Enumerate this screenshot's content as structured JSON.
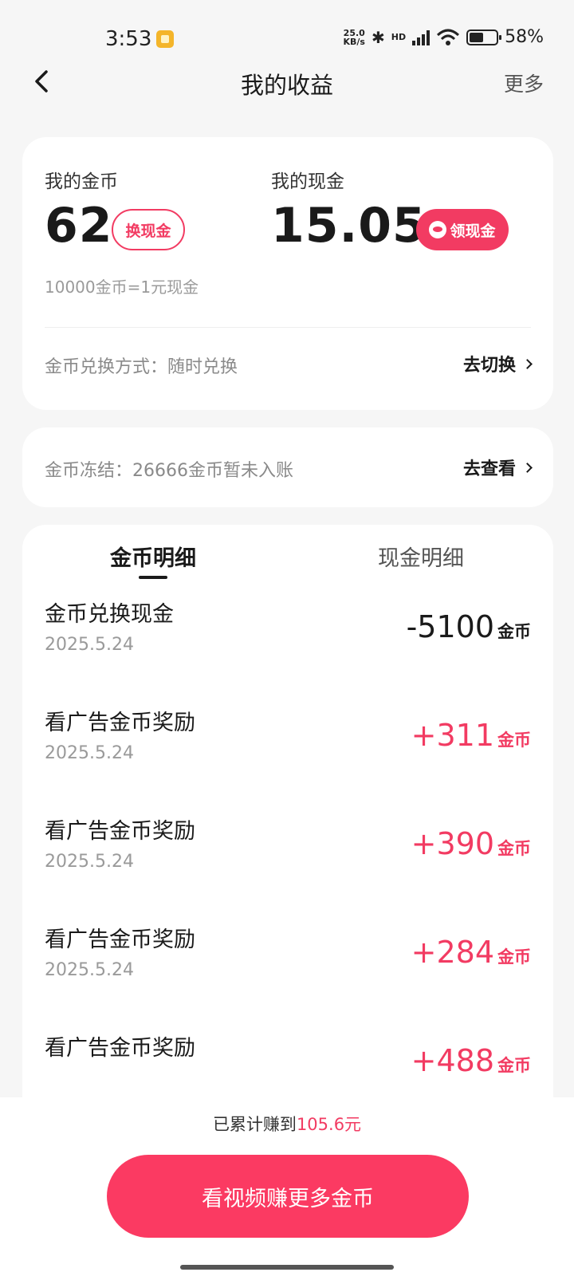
{
  "status_bar": {
    "time": "3:53",
    "net_speed_value": "25.0",
    "net_speed_unit": "KB/s",
    "bluetooth_icon": "bluetooth-icon",
    "signal_label": "HD",
    "wifi_icon": "wifi-icon",
    "battery_percent": "58%",
    "battery_level": 0.58
  },
  "header": {
    "title": "我的收益",
    "more_label": "更多",
    "back_icon": "chevron-left-icon"
  },
  "balance": {
    "coins_label": "我的金币",
    "coins_value": "62",
    "exchange_button": "换现金",
    "cash_label": "我的现金",
    "cash_value": "15.05",
    "withdraw_button": "领现金",
    "withdraw_icon": "wechat-icon",
    "rate_text": "10000金币=1元现金",
    "mode_text": "金币兑换方式：随时兑换",
    "switch_link": "去切换"
  },
  "frozen": {
    "text": "金币冻结：26666金币暂未入账",
    "view_link": "去查看"
  },
  "tabs": [
    {
      "label": "金币明细",
      "active": true
    },
    {
      "label": "现金明细",
      "active": false
    }
  ],
  "transactions": [
    {
      "title": "金币兑换现金",
      "date": "2025.5.24",
      "amount": "-5100",
      "unit": "金币"
    },
    {
      "title": "看广告金币奖励",
      "date": "2025.5.24",
      "amount": "+311",
      "unit": "金币"
    },
    {
      "title": "看广告金币奖励",
      "date": "2025.5.24",
      "amount": "+390",
      "unit": "金币"
    },
    {
      "title": "看广告金币奖励",
      "date": "2025.5.24",
      "amount": "+284",
      "unit": "金币"
    },
    {
      "title": "看广告金币奖励",
      "date": "",
      "amount": "+488",
      "unit": "金币"
    }
  ],
  "footer": {
    "earned_prefix": "已累计赚到",
    "earned_amount": "105.6元",
    "cta_button": "看视频赚更多金币"
  },
  "colors": {
    "accent": "#f23b62",
    "cta": "#fb3a62",
    "background": "#f6f6f6"
  }
}
